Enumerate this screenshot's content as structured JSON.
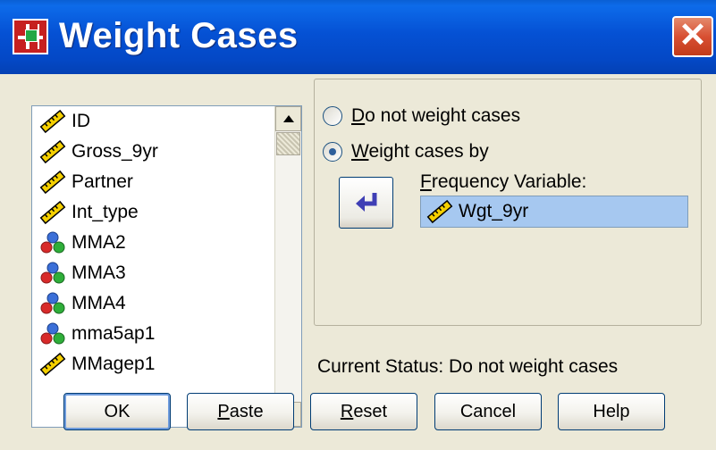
{
  "window": {
    "title": "Weight Cases",
    "close_glyph": "✕",
    "title_icon": "weight-cases-app-icon"
  },
  "variable_list": {
    "items": [
      {
        "label": "ID",
        "icon": "scale-ruler-icon"
      },
      {
        "label": "Gross_9yr",
        "icon": "scale-ruler-icon"
      },
      {
        "label": "Partner",
        "icon": "scale-ruler-icon"
      },
      {
        "label": "Int_type",
        "icon": "scale-ruler-icon"
      },
      {
        "label": "MMA2",
        "icon": "nominal-balls-icon"
      },
      {
        "label": "MMA3",
        "icon": "nominal-balls-icon"
      },
      {
        "label": "MMA4",
        "icon": "nominal-balls-icon"
      },
      {
        "label": "mma5ap1",
        "icon": "nominal-balls-icon"
      },
      {
        "label": "MMagep1",
        "icon": "scale-ruler-icon"
      }
    ]
  },
  "options": {
    "no_weight": {
      "accel": "D",
      "rest": "o not weight cases",
      "checked": false
    },
    "weight_by": {
      "accel": "W",
      "rest": "eight cases by",
      "checked": true
    }
  },
  "frequency": {
    "label_accel": "F",
    "label_rest": "requency Variable:",
    "value": "Wgt_9yr"
  },
  "status_text": "Current Status: Do not weight cases",
  "buttons": {
    "ok": "OK",
    "paste_accel": "P",
    "paste_rest": "aste",
    "reset_accel": "R",
    "reset_rest": "eset",
    "cancel": "Cancel",
    "help": "Help"
  },
  "colors": {
    "titlebar": "#0551d4",
    "selection": "#a6c8f0",
    "close": "#d85033"
  }
}
